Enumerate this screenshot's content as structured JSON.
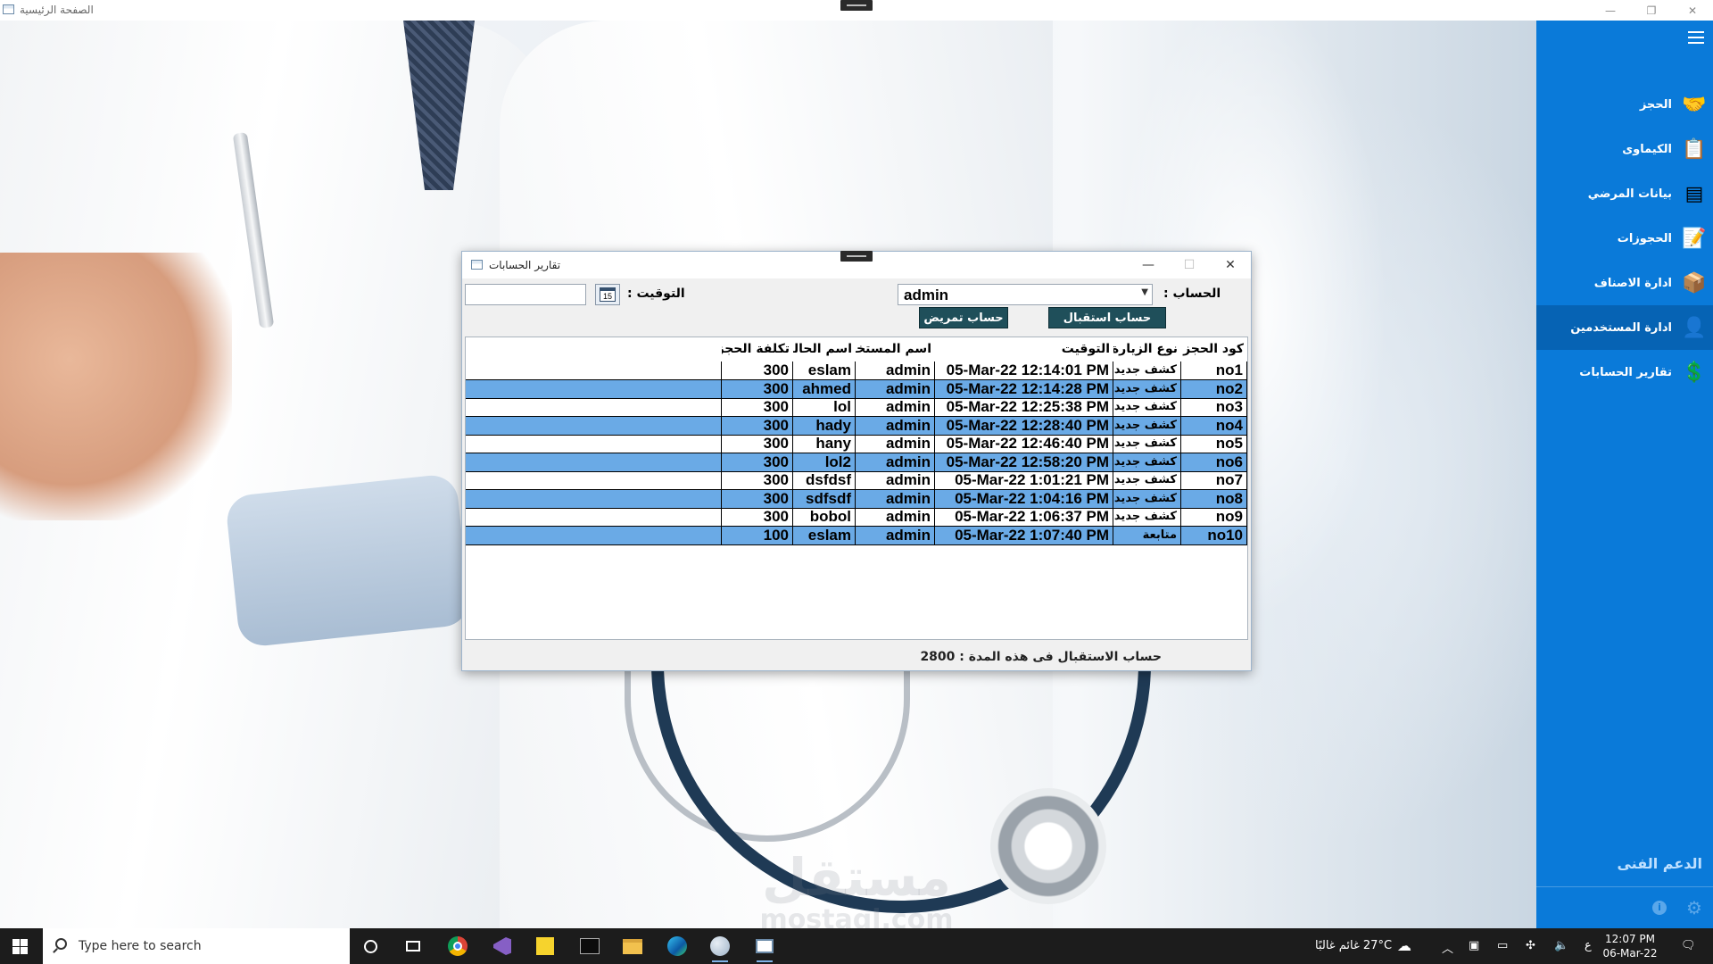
{
  "main_window": {
    "title": "الصفحة الرئيسية",
    "controls": {
      "minimize": "—",
      "restore": "❐",
      "close": "✕"
    }
  },
  "background": {
    "watermark_ar": "مستقل",
    "watermark_en": "mostaql.com"
  },
  "sidebar": {
    "bg_color": "#0a7ad9",
    "items": [
      {
        "label": "الحجز",
        "icon": "handshake-icon",
        "glyph": "🤝"
      },
      {
        "label": "الكيماوى",
        "icon": "clipboard-icon",
        "glyph": "📋"
      },
      {
        "label": "بيانات المرضي",
        "icon": "list-icon",
        "glyph": "▤"
      },
      {
        "label": "الحجوزات",
        "icon": "notes-icon",
        "glyph": "📝"
      },
      {
        "label": "ادارة الاصناف",
        "icon": "box-icon",
        "glyph": "📦"
      },
      {
        "label": "ادارة المستخدمين",
        "icon": "user-key-icon",
        "glyph": "👤"
      },
      {
        "label": "تقارير الحسابات",
        "icon": "money-icon",
        "glyph": "💲"
      }
    ],
    "active_index": 5,
    "support_label": "الدعم الفنى"
  },
  "dialog": {
    "title": "تقارير الحسابات",
    "account_label": "الحساب :",
    "account_value": "admin",
    "time_label": "التوقيت :",
    "date_value": "",
    "calendar_day": "15",
    "btn_reception": "حساب استقبال",
    "btn_nursing": "حساب تمريض",
    "columns": {
      "code": "كود الحجز",
      "visit_type": "نوع الزيارة",
      "time": "التوقيت",
      "user": "اسم المستخدم",
      "patient": "اسم الحالة",
      "cost": "تكلفة الحجز"
    },
    "rows": [
      {
        "code": "no1",
        "visit_type": "كشف جديد",
        "time": "05-Mar-22 12:14:01 PM",
        "user": "admin",
        "patient": "eslam",
        "cost": "300"
      },
      {
        "code": "no2",
        "visit_type": "كشف جديد",
        "time": "05-Mar-22 12:14:28 PM",
        "user": "admin",
        "patient": "ahmed",
        "cost": "300"
      },
      {
        "code": "no3",
        "visit_type": "كشف جديد",
        "time": "05-Mar-22 12:25:38 PM",
        "user": "admin",
        "patient": "lol",
        "cost": "300"
      },
      {
        "code": "no4",
        "visit_type": "كشف جديد",
        "time": "05-Mar-22 12:28:40 PM",
        "user": "admin",
        "patient": "hady",
        "cost": "300"
      },
      {
        "code": "no5",
        "visit_type": "كشف جديد",
        "time": "05-Mar-22 12:46:40 PM",
        "user": "admin",
        "patient": "hany",
        "cost": "300"
      },
      {
        "code": "no6",
        "visit_type": "كشف جديد",
        "time": "05-Mar-22 12:58:20 PM",
        "user": "admin",
        "patient": "lol2",
        "cost": "300"
      },
      {
        "code": "no7",
        "visit_type": "كشف جديد",
        "time": "05-Mar-22 1:01:21 PM",
        "user": "admin",
        "patient": "dsfdsf",
        "cost": "300"
      },
      {
        "code": "no8",
        "visit_type": "كشف جديد",
        "time": "05-Mar-22 1:04:16 PM",
        "user": "admin",
        "patient": "sdfsdf",
        "cost": "300"
      },
      {
        "code": "no9",
        "visit_type": "كشف جديد",
        "time": "05-Mar-22 1:06:37 PM",
        "user": "admin",
        "patient": "bobol",
        "cost": "300"
      },
      {
        "code": "no10",
        "visit_type": "متابعة",
        "time": "05-Mar-22 1:07:40 PM",
        "user": "admin",
        "patient": "eslam",
        "cost": "100"
      }
    ],
    "summary_text": "حساب الاستقبال فى هذه المدة : 2800",
    "row_alt_color": "#6aaae6"
  },
  "taskbar": {
    "search_placeholder": "Type here to search",
    "weather": "27°C  غائم غالبًا",
    "lang": "ع",
    "time": "12:07 PM",
    "date": "06-Mar-22"
  }
}
